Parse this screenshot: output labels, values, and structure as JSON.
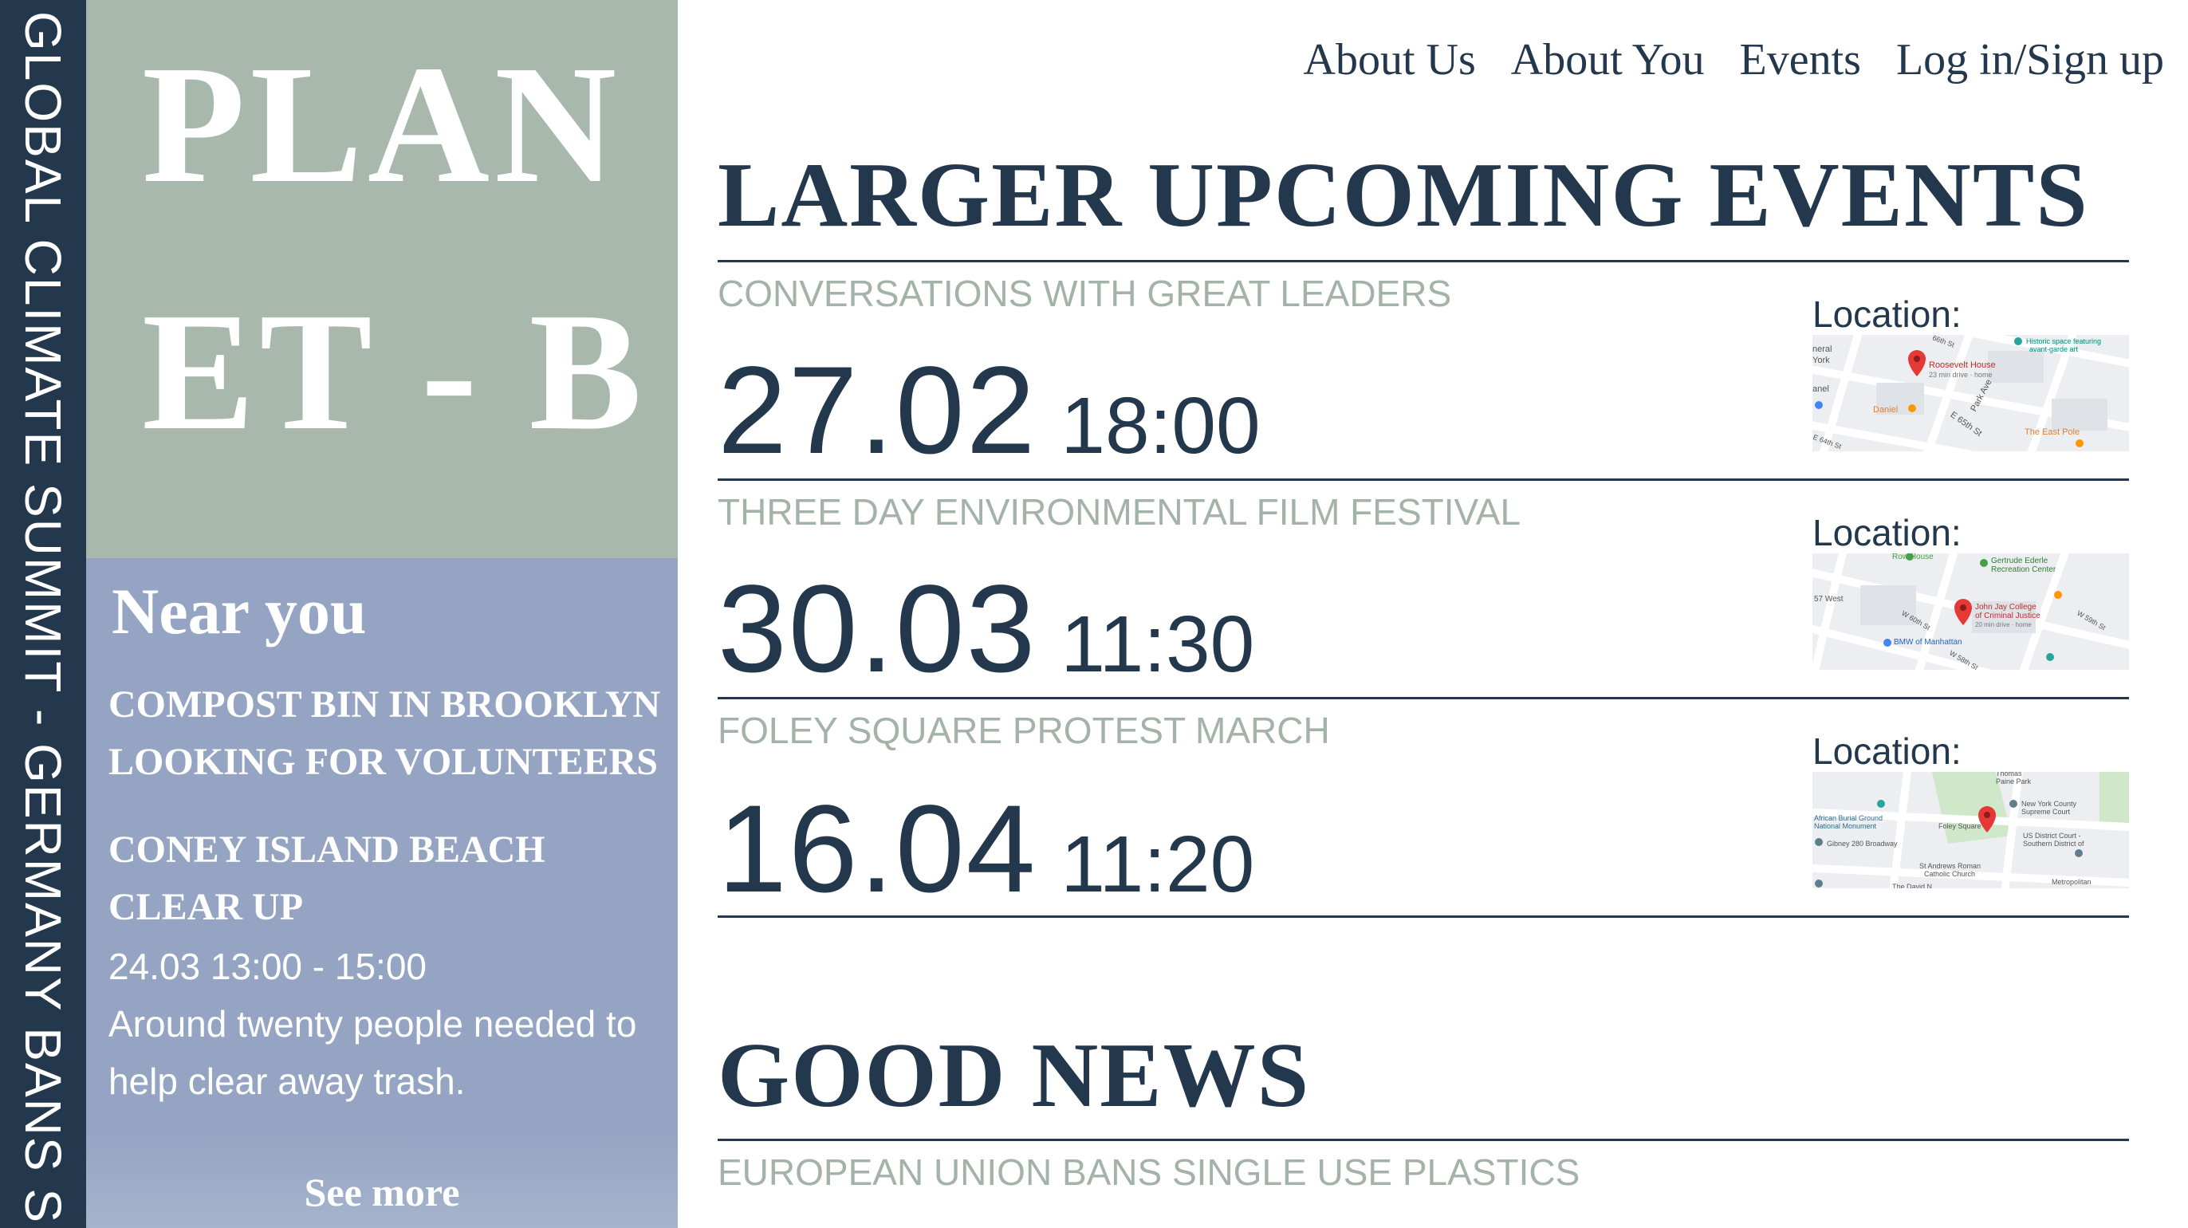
{
  "ticker": {
    "text": "GLOBAL CLIMATE SUMMIT - GERMANY BANS SI"
  },
  "logo": {
    "line1": "PLAN",
    "line2": "ET - B"
  },
  "near_you": {
    "title": "Near you",
    "items": [
      {
        "title": "COMPOST BIN IN BROOKLYN LOOKING FOR VOLUNTEERS"
      },
      {
        "title": "CONEY ISLAND BEACH CLEAR UP",
        "time": "24.03 13:00 - 15:00",
        "description": "Around twenty people needed to help clear away trash."
      }
    ],
    "see_more": "See more"
  },
  "nav": {
    "items": [
      {
        "label": "About Us"
      },
      {
        "label": "About You"
      },
      {
        "label": "Events"
      },
      {
        "label": "Log in/Sign up"
      }
    ]
  },
  "events_section": {
    "title": "LARGER UPCOMING EVENTS",
    "location_label": "Location:",
    "events": [
      {
        "name": "CONVERSATIONS WITH GREAT LEADERS",
        "date": "27.02",
        "time": "18:00",
        "map_labels": [
          "Roosevelt House",
          "23 min drive · home",
          "Historic space featuring",
          "avant-garde art",
          "Daniel",
          "The East Pole",
          "E 65th St",
          "Park Ave",
          "neral",
          "York",
          "anel",
          "E 64th St",
          "66th St"
        ]
      },
      {
        "name": "THREE DAY ENVIRONMENTAL FILM FESTIVAL",
        "date": "30.03",
        "time": "11:30",
        "map_labels": [
          "Row House",
          "Gertrude Ederle",
          "Recreation Center",
          "John Jay College",
          "of Criminal Justice",
          "20 min drive · home",
          "BMW of Manhattan",
          "57 West",
          "W 60th St",
          "W 59th St",
          "W 58th St"
        ]
      },
      {
        "name": "FOLEY SQUARE PROTEST MARCH",
        "date": "16.04",
        "time": "11:20",
        "map_labels": [
          "African Burial Ground",
          "National Monument",
          "Gibney 280 Broadway",
          "Foley Square",
          "New York County",
          "Supreme Court",
          "US District Court -",
          "Southern District of",
          "St Andrews Roman",
          "Catholic Church",
          "Metropolitan",
          "Thomas",
          "Paine Park",
          "The David N"
        ]
      }
    ]
  },
  "good_news": {
    "title": "GOOD NEWS",
    "items": [
      {
        "title": "EUROPEAN UNION BANS SINGLE USE PLASTICS"
      }
    ]
  },
  "colors": {
    "navy": "#24384d",
    "sage": "#a8b8ad",
    "periwinkle": "#94a4c2",
    "sage_text": "#a3b3a8",
    "map_pin": "#e53935"
  }
}
